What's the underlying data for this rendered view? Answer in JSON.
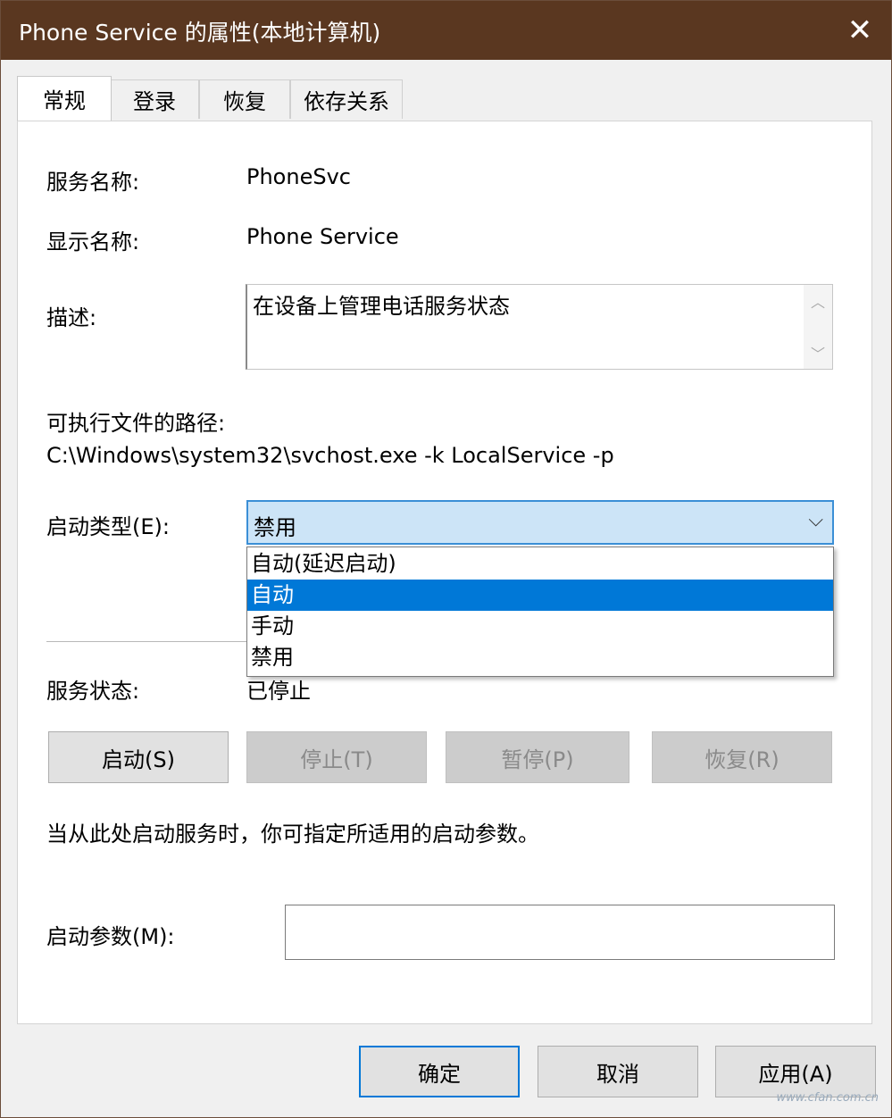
{
  "window": {
    "title": "Phone Service 的属性(本地计算机)",
    "close_icon": "close-icon"
  },
  "tabs": [
    {
      "label": "常规",
      "active": true
    },
    {
      "label": "登录",
      "active": false
    },
    {
      "label": "恢复",
      "active": false
    },
    {
      "label": "依存关系",
      "active": false
    }
  ],
  "general": {
    "service_name_label": "服务名称:",
    "service_name_value": "PhoneSvc",
    "display_name_label": "显示名称:",
    "display_name_value": "Phone Service",
    "description_label": "描述:",
    "description_value": "在设备上管理电话服务状态",
    "path_label": "可执行文件的路径:",
    "path_value": "C:\\Windows\\system32\\svchost.exe -k LocalService -p",
    "startup_type_label": "启动类型(E):",
    "startup_type_value": "禁用",
    "startup_options": [
      "自动(延迟启动)",
      "自动",
      "手动",
      "禁用"
    ],
    "highlighted_option": "自动",
    "status_label": "服务状态:",
    "status_value": "已停止",
    "buttons": {
      "start": "启动(S)",
      "stop": "停止(T)",
      "pause": "暂停(P)",
      "resume": "恢复(R)"
    },
    "hint": "当从此处启动服务时，你可指定所适用的启动参数。",
    "params_label": "启动参数(M):",
    "params_value": ""
  },
  "footer": {
    "ok": "确定",
    "cancel": "取消",
    "apply": "应用(A)"
  },
  "watermark": "www.cfan.com.cn",
  "colors": {
    "titlebar": "#5a3720",
    "combo_bg": "#cce4f7",
    "selection": "#0078d7"
  }
}
